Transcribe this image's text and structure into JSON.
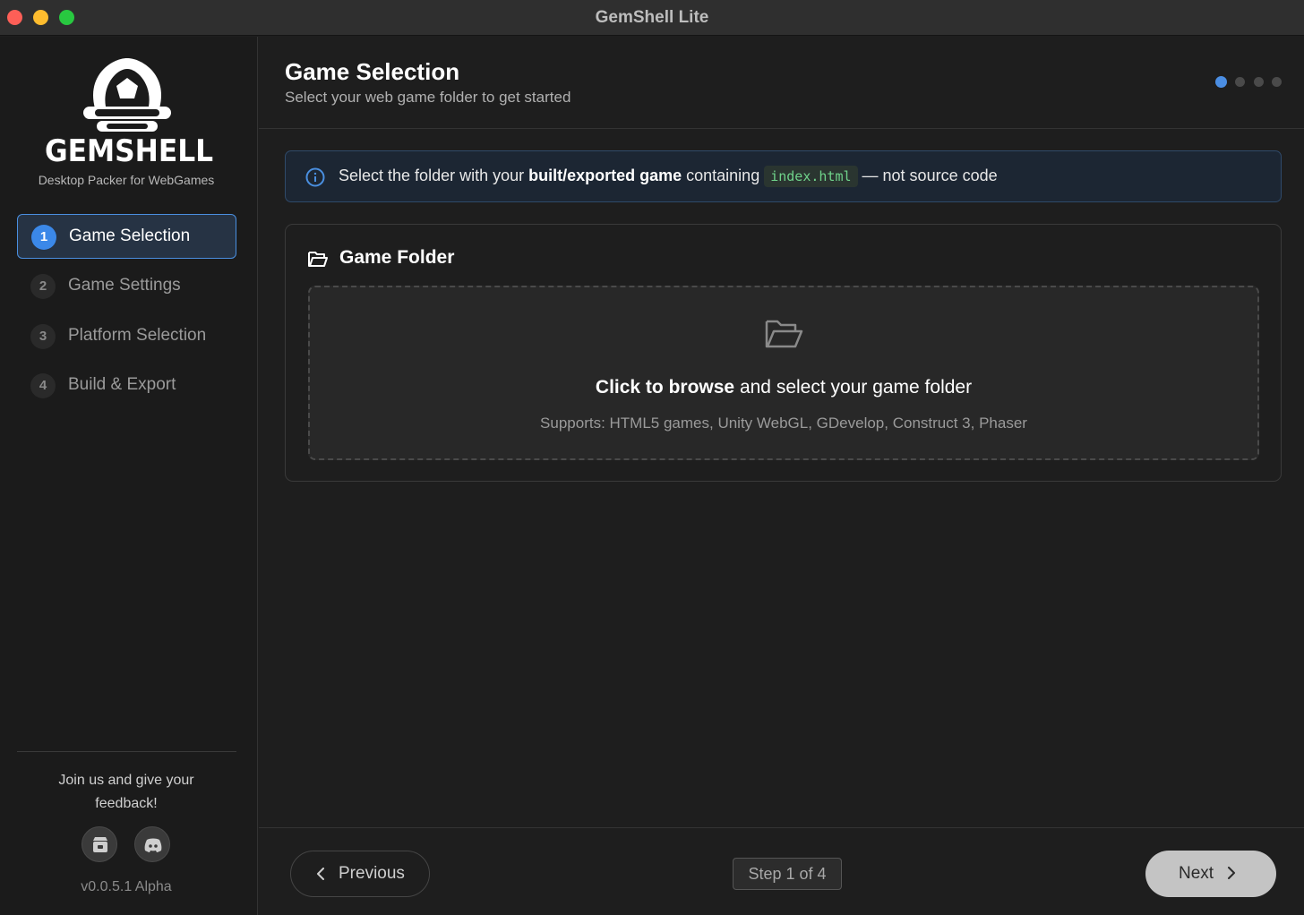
{
  "window": {
    "title": "GemShell Lite"
  },
  "sidebar": {
    "logo_text": "GEMSHELL",
    "tagline": "Desktop Packer for WebGames",
    "items": [
      {
        "number": "1",
        "label": "Game Selection",
        "active": true
      },
      {
        "number": "2",
        "label": "Game Settings",
        "active": false
      },
      {
        "number": "3",
        "label": "Platform Selection",
        "active": false
      },
      {
        "number": "4",
        "label": "Build & Export",
        "active": false
      }
    ],
    "feedback_text": "Join us and give your feedback!",
    "social_icons": [
      "store-icon",
      "discord-icon"
    ],
    "version": "v0.0.5.1 Alpha"
  },
  "header": {
    "title": "Game Selection",
    "subtitle": "Select your web game folder to get started",
    "progress": {
      "total_steps": 4,
      "current_step": 1
    }
  },
  "info_banner": {
    "text_before": "Select the folder with your ",
    "text_bold": "built/exported game",
    "text_middle": " containing ",
    "code": "index.html",
    "text_after": " — not source code"
  },
  "game_folder": {
    "title": "Game Folder",
    "drop_bold": "Click to browse",
    "drop_rest": " and select your game folder",
    "supports": "Supports: HTML5 games, Unity WebGL, GDevelop, Construct 3, Phaser"
  },
  "footer": {
    "previous_label": "Previous",
    "step_text": "Step 1 of 4",
    "next_label": "Next"
  },
  "colors": {
    "accent": "#3b88e8",
    "background": "#1e1e1e",
    "code_green": "#6fd28a"
  }
}
